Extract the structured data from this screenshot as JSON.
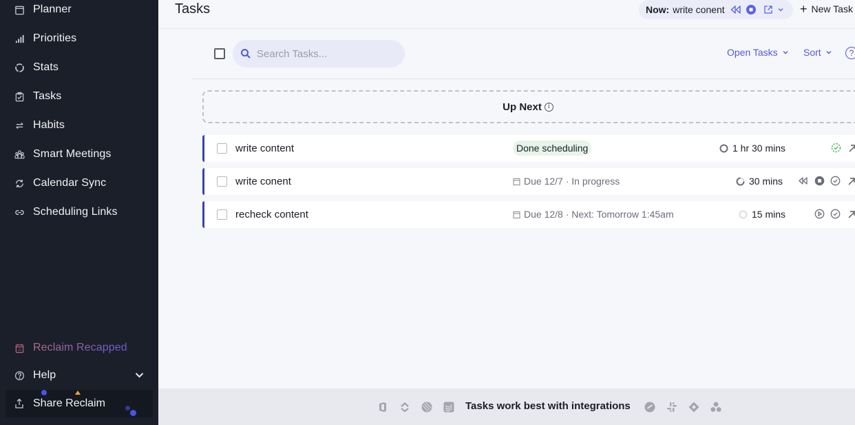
{
  "sidebar": {
    "items": [
      {
        "label": "Planner",
        "icon": "calendar-icon"
      },
      {
        "label": "Priorities",
        "icon": "bar-signal-icon"
      },
      {
        "label": "Stats",
        "icon": "ring-chart-icon"
      },
      {
        "label": "Tasks",
        "icon": "clipboard-check-icon"
      },
      {
        "label": "Habits",
        "icon": "repeat-icon"
      },
      {
        "label": "Smart Meetings",
        "icon": "people-icon"
      },
      {
        "label": "Calendar Sync",
        "icon": "sync-icon"
      },
      {
        "label": "Scheduling Links",
        "icon": "link-icon"
      }
    ],
    "recap": {
      "label": "Reclaim Recapped",
      "icon": "calendar-23-icon"
    },
    "help": {
      "label": "Help",
      "icon": "question-circle-icon"
    },
    "share": {
      "label": "Share Reclaim",
      "icon": "share-upload-icon"
    }
  },
  "header": {
    "title": "Tasks",
    "now": {
      "label": "Now:",
      "task": "write conent"
    },
    "new_task_label": "New Task"
  },
  "toolbar": {
    "search_placeholder": "Search Tasks...",
    "search_value": "",
    "filter_label": "Open Tasks",
    "sort_label": "Sort",
    "help_label": "?"
  },
  "up_next": {
    "label": "Up Next",
    "info": "i"
  },
  "tasks": [
    {
      "title": "write content",
      "status_badge": "Done scheduling",
      "due": "",
      "duration": "1 hr 30 mins",
      "progress_state": "not-started",
      "actions": [
        "done-dashed-check",
        "open-arrow"
      ]
    },
    {
      "title": "write conent",
      "status_badge": "",
      "due": "Due 12/7 · In progress",
      "duration": "30 mins",
      "progress_state": "in-progress",
      "actions": [
        "restart",
        "stop",
        "complete",
        "open-arrow"
      ]
    },
    {
      "title": "recheck content",
      "status_badge": "",
      "due": "Due 12/8 · Next: Tomorrow 1:45am",
      "duration": "15 mins",
      "progress_state": "pending",
      "actions": [
        "play",
        "complete",
        "open-arrow"
      ]
    }
  ],
  "bottom_bar": {
    "message": "Tasks work best with integrations",
    "left_icons": [
      "office-icon",
      "jira-icon",
      "linear-icon",
      "todoist-icon"
    ],
    "right_icons": [
      "clickup-icon",
      "slack-icon",
      "zapier-icon",
      "asana-icon"
    ]
  },
  "colors": {
    "accent": "#5158e0",
    "sidebar_bg": "#1b1f29",
    "row_accent": "#3741b2",
    "done_badge_bg": "#e7f4ea",
    "done_check": "#3fb04f"
  }
}
